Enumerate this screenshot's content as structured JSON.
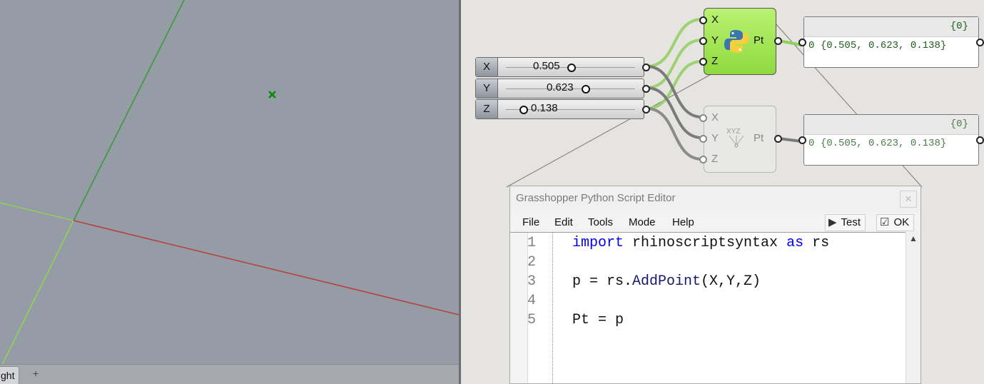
{
  "viewport": {
    "tab_label": "ght",
    "add_tab_icon": "plus-icon",
    "colors": {
      "background": "#959ca6",
      "x_axis": "#b5433f",
      "y_axis": "#3a9b3a",
      "z_axis": "#8fe040",
      "point": "#0c8a0c"
    }
  },
  "sliders": [
    {
      "label": "X",
      "value": "0.505"
    },
    {
      "label": "Y",
      "value": "0.623"
    },
    {
      "label": "Z",
      "value": "0.138"
    }
  ],
  "python_component": {
    "inputs": [
      "X",
      "Y",
      "Z"
    ],
    "output": "Pt",
    "icon": "python-logo-icon",
    "color": "#9be350"
  },
  "construct_point_component": {
    "inputs": [
      "X",
      "Y",
      "Z"
    ],
    "output": "Pt",
    "icon": "xyz-point-icon"
  },
  "panels": [
    {
      "path": "{0}",
      "index": "0",
      "value": "{0.505, 0.623, 0.138}"
    },
    {
      "path": "{0}",
      "index": "0",
      "value": "{0.505, 0.623, 0.138}"
    }
  ],
  "editor": {
    "title": "Grasshopper Python Script Editor",
    "close_icon": "close-icon",
    "menu": [
      "File",
      "Edit",
      "Tools",
      "Mode",
      "Help"
    ],
    "test_label": "Test",
    "ok_label": "OK",
    "line_numbers": [
      "1",
      "2",
      "3",
      "4",
      "5"
    ],
    "code": {
      "line1_kw1": "import",
      "line1_mod": " rhinoscriptsyntax ",
      "line1_kw2": "as",
      "line1_alias": " rs",
      "line3_pre": "p = rs.",
      "line3_fn": "AddPoint",
      "line3_args": "(X,Y,Z)",
      "line5": "Pt = p"
    }
  }
}
